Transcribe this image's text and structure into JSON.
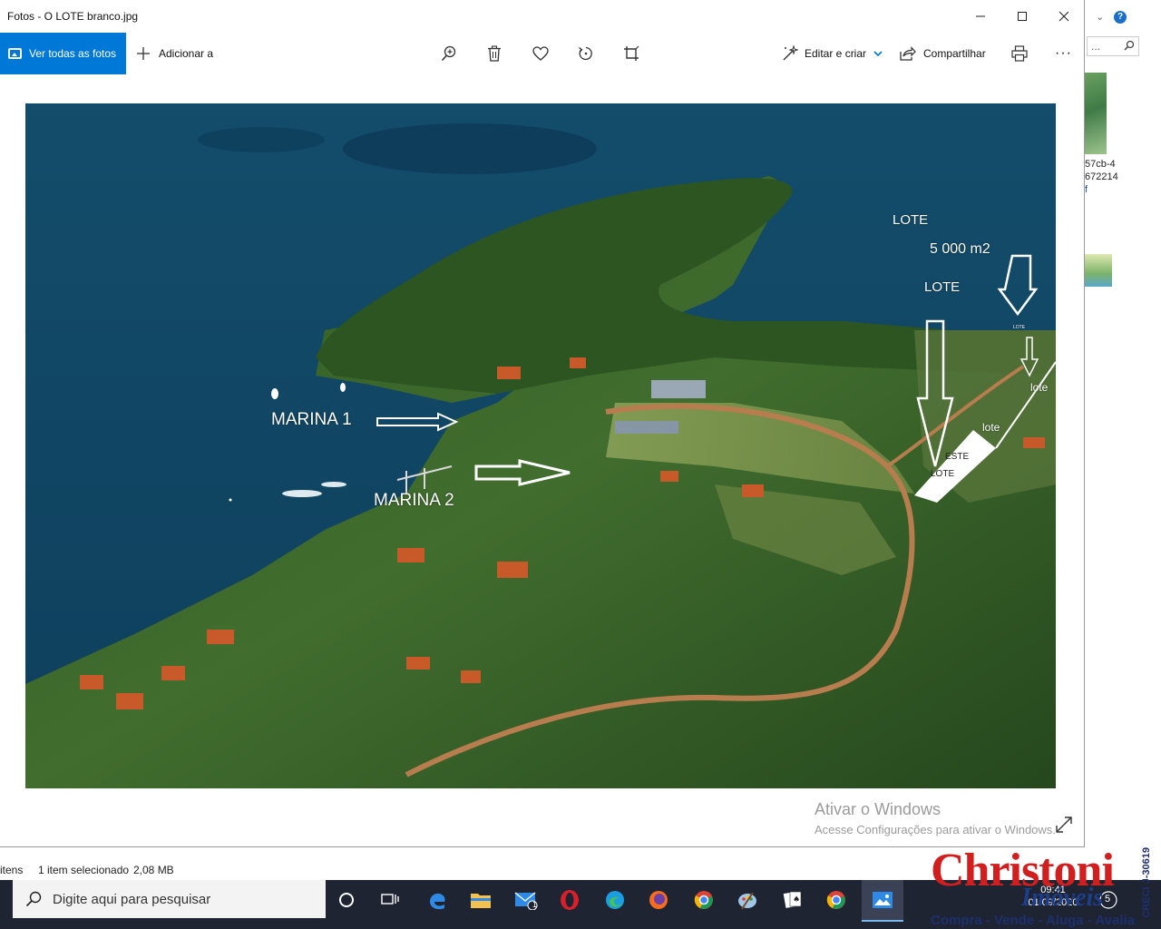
{
  "window": {
    "title": "Fotos - O  LOTE branco.jpg",
    "controls": {
      "minimize": "—",
      "maximize": "☐",
      "close": "✕"
    }
  },
  "toolbar": {
    "view_all": "Ver todas as fotos",
    "add_to": "Adicionar a",
    "edit_create": "Editar e criar",
    "share": "Compartilhar",
    "more": "···"
  },
  "photo": {
    "labels": {
      "lote_top": "LOTE",
      "area": "5 000 m2",
      "lote_mid": "LOTE",
      "marina1": "MARINA 1",
      "marina2": "MARINA 2",
      "este": "ESTE",
      "lote_box": "LOTE",
      "lote_small1": "lote",
      "lote_small2": "lote",
      "lote_tiny": "LOTE"
    }
  },
  "activation": {
    "heading": "Ativar o Windows",
    "subtext": "Acesse Configurações para ativar o Windows."
  },
  "explorer": {
    "search_placeholder": "...",
    "caption_lines": [
      "57cb-4",
      "672214",
      "f"
    ],
    "status": {
      "items": "itens",
      "selected": "1 item selecionado",
      "size": "2,08 MB"
    }
  },
  "taskbar": {
    "search_placeholder": "Digite aqui para pesquisar",
    "mail_badge": "1",
    "time": "09:41",
    "date": "01/09/2020",
    "notifications": "5"
  },
  "watermark": {
    "brand": "Christoni",
    "sub": "Imóveis",
    "tagline": "Compra - Vende - Aluga - Avalia",
    "creci": "CRECI J-30619"
  },
  "colors": {
    "accent": "#0078d7",
    "taskbar": "#1f2433",
    "brand_red": "#d11f1f",
    "brand_blue": "#1d3e8a"
  }
}
